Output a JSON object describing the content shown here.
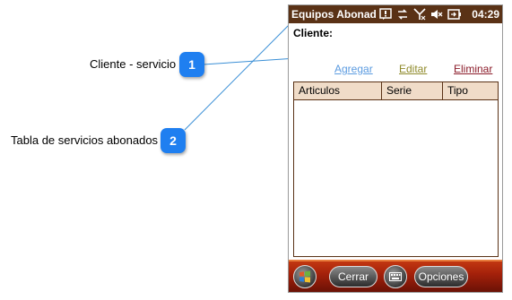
{
  "annotations": [
    {
      "number": "1",
      "label": "Cliente - servicio"
    },
    {
      "number": "2",
      "label": "Tabla de servicios abonados"
    }
  ],
  "device": {
    "title": "Equipos Abonad",
    "clock": "04:29",
    "status_icons": [
      "notification-icon",
      "data-sync-icon",
      "signal-off-icon",
      "volume-muted-icon",
      "battery-icon"
    ],
    "client_label": "Cliente:",
    "client_value": "",
    "actions": {
      "add": "Agregar",
      "edit": "Editar",
      "delete": "Eliminar"
    },
    "table": {
      "columns": [
        "Articulos",
        "Serie",
        "Tipo"
      ],
      "rows": []
    },
    "menubar": {
      "left": "Cerrar",
      "right": "Opciones",
      "start_icon": "windows-start-icon",
      "keyboard_icon": "keyboard-icon"
    },
    "colors": {
      "titlebar": "#5a3216",
      "header_bg": "#f0dcc8",
      "menubar": "#a3200a",
      "callout": "#1f7ff0"
    }
  }
}
